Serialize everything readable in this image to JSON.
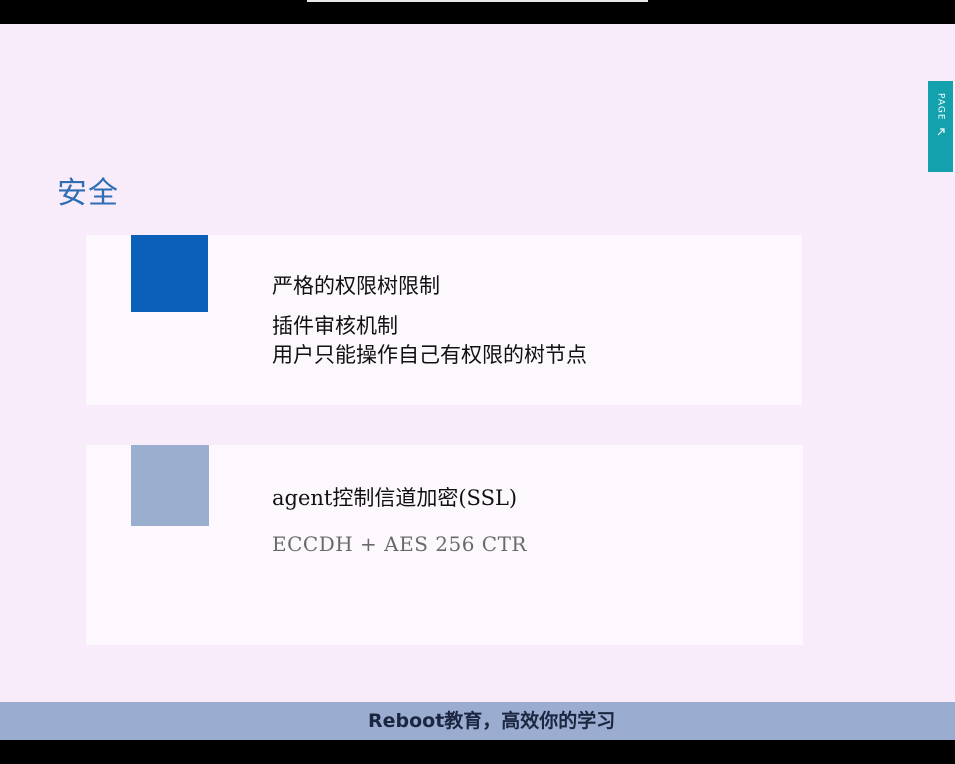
{
  "slide": {
    "title": "安全",
    "cards": [
      {
        "heading": "严格的权限树限制",
        "lines": [
          "插件审核机制",
          "用户只能操作自己有权限的树节点"
        ],
        "accent_color": "#0b5fb8"
      },
      {
        "heading": "agent控制信道加密(SSL)",
        "lines": [
          "ECCDH + AES 256 CTR"
        ],
        "accent_color": "#9aaed0"
      }
    ]
  },
  "side_tab": {
    "label": "PAGE",
    "icon": "arrow-icon",
    "color": "#12a1ad"
  },
  "caption": {
    "text": "Reboot教育，高效你的学习"
  },
  "colors": {
    "slide_background": "#f8ecfb",
    "card_background": "#fdf8fe",
    "title": "#2e6db3",
    "caption_bar": "#9aaccf"
  }
}
